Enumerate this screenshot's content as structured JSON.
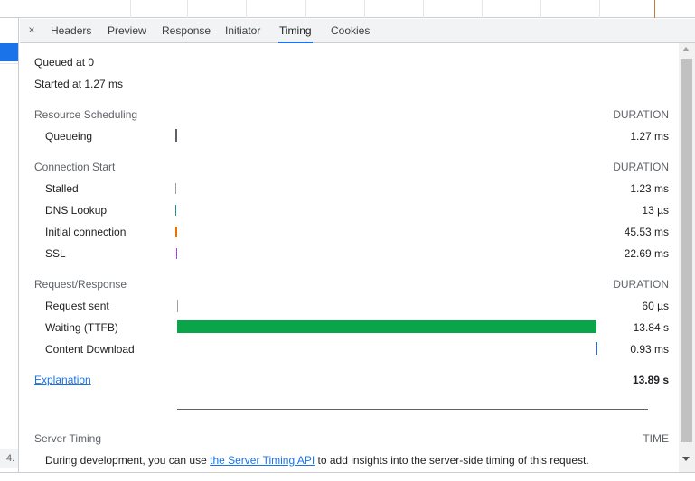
{
  "tabs": {
    "close_symbol": "×",
    "items": [
      "Headers",
      "Preview",
      "Response",
      "Initiator",
      "Timing",
      "Cookies"
    ],
    "active": "Timing"
  },
  "summary": {
    "queued": "Queued at 0",
    "started": "Started at 1.27 ms"
  },
  "duration_header": "DURATION",
  "sections": {
    "scheduling": {
      "title": "Resource Scheduling",
      "rows": [
        {
          "label": "Queueing",
          "value": "1.27 ms",
          "color": "#5f6368"
        }
      ]
    },
    "connection": {
      "title": "Connection Start",
      "rows": [
        {
          "label": "Stalled",
          "value": "1.23 ms",
          "color": "#9aa0a6"
        },
        {
          "label": "DNS Lookup",
          "value": "13 µs",
          "color": "#1e8e9e"
        },
        {
          "label": "Initial connection",
          "value": "45.53 ms",
          "color": "#e37400"
        },
        {
          "label": "SSL",
          "value": "22.69 ms",
          "color": "#a142f4"
        }
      ]
    },
    "request": {
      "title": "Request/Response",
      "rows": [
        {
          "label": "Request sent",
          "value": "60 µs",
          "color": "#9aa0a6"
        },
        {
          "label": "Waiting (TTFB)",
          "value": "13.84 s",
          "color": "#0aa54a"
        },
        {
          "label": "Content Download",
          "value": "0.93 ms",
          "color": "#1a73e8"
        }
      ]
    }
  },
  "explanation_link": "Explanation",
  "total": "13.89 s",
  "server_timing": {
    "title": "Server Timing",
    "time_header": "TIME",
    "text_before": "During development, you can use ",
    "link": "the Server Timing API",
    "text_after": " to add insights into the server-side timing of this request."
  },
  "request_list": {
    "visible_row_number": "4."
  }
}
